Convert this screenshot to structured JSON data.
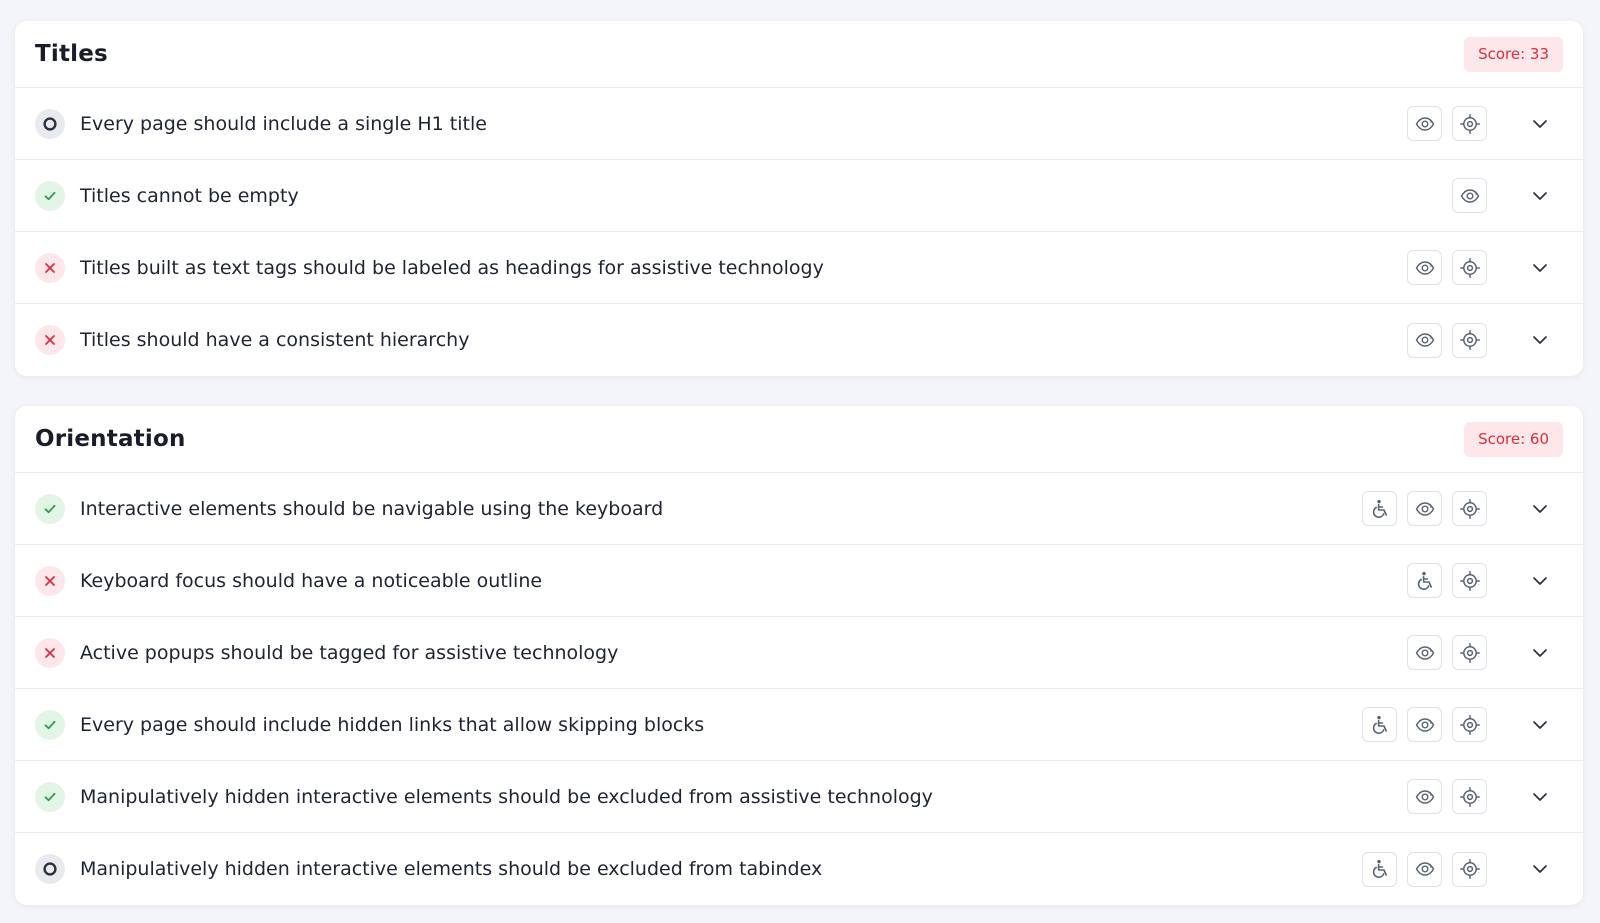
{
  "colors": {
    "pass": "#2f9e4a",
    "fail": "#d6313c",
    "pending": "#4a5266",
    "badge_bg": "#fde7ea",
    "badge_text": "#d6313c"
  },
  "icons": {
    "pass": "check-icon",
    "fail": "x-icon",
    "pending": "circle-icon",
    "accessibility": "wheelchair-icon",
    "visibility": "eye-icon",
    "locate": "crosshair-icon",
    "expand": "chevron-down-icon"
  },
  "sections": [
    {
      "title": "Titles",
      "score": "Score: 33",
      "rows": [
        {
          "status": "pending",
          "text": "Every page should include a single H1 title",
          "actions": [
            "visibility",
            "locate"
          ]
        },
        {
          "status": "pass",
          "text": "Titles cannot be empty",
          "actions": [
            "visibility"
          ]
        },
        {
          "status": "fail",
          "text": "Titles built as text tags should be labeled as headings for assistive technology",
          "actions": [
            "visibility",
            "locate"
          ]
        },
        {
          "status": "fail",
          "text": "Titles should have a consistent hierarchy",
          "actions": [
            "visibility",
            "locate"
          ]
        }
      ]
    },
    {
      "title": "Orientation",
      "score": "Score: 60",
      "rows": [
        {
          "status": "pass",
          "text": "Interactive elements should be navigable using the keyboard",
          "actions": [
            "accessibility",
            "visibility",
            "locate"
          ]
        },
        {
          "status": "fail",
          "text": "Keyboard focus should have a noticeable outline",
          "actions": [
            "accessibility",
            "locate"
          ]
        },
        {
          "status": "fail",
          "text": "Active popups should be tagged for assistive technology",
          "actions": [
            "visibility",
            "locate"
          ]
        },
        {
          "status": "pass",
          "text": "Every page should include hidden links that allow skipping blocks",
          "actions": [
            "accessibility",
            "visibility",
            "locate"
          ]
        },
        {
          "status": "pass",
          "text": "Manipulatively hidden interactive elements should be excluded from assistive technology",
          "actions": [
            "visibility",
            "locate"
          ]
        },
        {
          "status": "pending",
          "text": "Manipulatively hidden interactive elements should be excluded from tabindex",
          "actions": [
            "accessibility",
            "visibility",
            "locate"
          ]
        }
      ]
    }
  ]
}
